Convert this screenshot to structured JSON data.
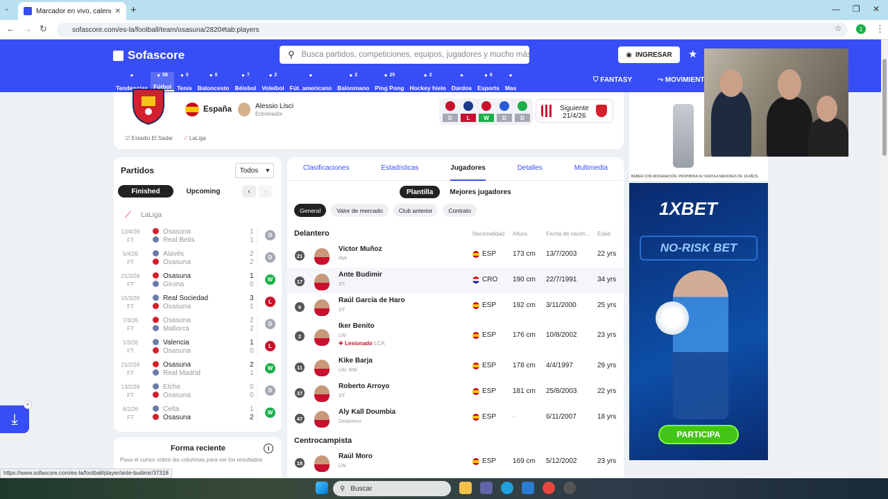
{
  "browser": {
    "tab_title": "Marcador en vivo, calendario y",
    "url": "sofascore.com/es-la/football/team/osasuna/2820#tab:players",
    "status_url": "https://www.sofascore.com/es-la/football/player/ante-budimir/37318"
  },
  "header": {
    "logo": "Sofascore",
    "search_placeholder": "Busca partidos, competiciones, equipos, jugadores y mucho más",
    "login": "INGRESAR",
    "fantasy": "FANTASY",
    "movimientos": "MOVIMIENT"
  },
  "sports": [
    {
      "label": "Tendencias",
      "count": ""
    },
    {
      "label": "Fútbol",
      "count": "58"
    },
    {
      "label": "Tenis",
      "count": "5"
    },
    {
      "label": "Baloncesto",
      "count": "8"
    },
    {
      "label": "Béisbol",
      "count": "7"
    },
    {
      "label": "Voleibol",
      "count": "2"
    },
    {
      "label": "Fút. americano",
      "count": ""
    },
    {
      "label": "Balonmano",
      "count": "2"
    },
    {
      "label": "Ping Pong",
      "count": "25"
    },
    {
      "label": "Hockey hielo",
      "count": "2"
    },
    {
      "label": "Dardos",
      "count": ""
    },
    {
      "label": "Esports",
      "count": "6"
    },
    {
      "label": "Mas",
      "count": ""
    }
  ],
  "team": {
    "country": "España",
    "coach": "Alessio Lisci",
    "coach_role": "Entrenador",
    "venue": "Estadio El Sadar",
    "league": "LaLiga",
    "form": [
      "D",
      "L",
      "W",
      "D",
      "D"
    ],
    "next_label": "Siguiente",
    "next_date": "21/4/26"
  },
  "colors": {
    "brand": "#374df5",
    "win": "#1bb04a",
    "loss": "#c8102e",
    "draw": "#a4a9b3"
  },
  "matches": {
    "title": "Partidos",
    "filter": "Todos",
    "tab_finished": "Finished",
    "tab_upcoming": "Upcoming",
    "league": "LaLiga",
    "rows": [
      {
        "date": "12/4/26",
        "status": "FT",
        "home": "Osasuna",
        "away": "Real Betis",
        "hs": "1",
        "as": "1",
        "res": "D",
        "hw": false,
        "aw": false
      },
      {
        "date": "5/4/26",
        "status": "FT",
        "home": "Alavés",
        "away": "Osasuna",
        "hs": "2",
        "as": "2",
        "res": "D",
        "hw": false,
        "aw": false
      },
      {
        "date": "21/3/26",
        "status": "FT",
        "home": "Osasuna",
        "away": "Girona",
        "hs": "1",
        "as": "0",
        "res": "W",
        "hw": true,
        "aw": false
      },
      {
        "date": "15/3/26",
        "status": "FT",
        "home": "Real Sociedad",
        "away": "Osasuna",
        "hs": "3",
        "as": "1",
        "res": "L",
        "hw": true,
        "aw": false
      },
      {
        "date": "7/3/26",
        "status": "FT",
        "home": "Osasuna",
        "away": "Mallorca",
        "hs": "2",
        "as": "2",
        "res": "D",
        "hw": false,
        "aw": false
      },
      {
        "date": "1/3/26",
        "status": "FT",
        "home": "Valencia",
        "away": "Osasuna",
        "hs": "1",
        "as": "0",
        "res": "L",
        "hw": true,
        "aw": false
      },
      {
        "date": "21/2/26",
        "status": "FT",
        "home": "Osasuna",
        "away": "Real Madrid",
        "hs": "2",
        "as": "1",
        "res": "W",
        "hw": true,
        "aw": false
      },
      {
        "date": "13/2/26",
        "status": "FT",
        "home": "Elche",
        "away": "Osasuna",
        "hs": "0",
        "as": "0",
        "res": "D",
        "hw": false,
        "aw": false
      },
      {
        "date": "6/2/26",
        "status": "FT",
        "home": "Celta",
        "away": "Osasuna",
        "hs": "1",
        "as": "2",
        "res": "W",
        "hw": false,
        "aw": true
      }
    ]
  },
  "form_panel": {
    "title": "Forma reciente",
    "subtitle": "Pasa el cursor sobre las columnas para ver los resultados"
  },
  "main_tabs": [
    "Clasificaciones",
    "Estadísticas",
    "Jugadores",
    "Detalles",
    "Multimedia"
  ],
  "segments": [
    "Plantilla",
    "Mejores jugadores"
  ],
  "filters": [
    "General",
    "Valor de mercado",
    "Club anterior",
    "Contrato"
  ],
  "columns": {
    "nat": "Nacionalidad",
    "height": "Altura",
    "birth": "Fecha de nacim...",
    "age": "Edad"
  },
  "sections": {
    "forwards": "Delantero",
    "midfielders": "Centrocampista"
  },
  "forwards": [
    {
      "num": "21",
      "name": "Victor Muñoz",
      "pos": "RW",
      "nat": "ESP",
      "height": "173 cm",
      "birth": "13/7/2003",
      "age": "22 yrs"
    },
    {
      "num": "17",
      "name": "Ante Budimir",
      "pos": "ST",
      "nat": "CRO",
      "height": "190 cm",
      "birth": "22/7/1991",
      "age": "34 yrs"
    },
    {
      "num": "9",
      "name": "Raúl García de Haro",
      "pos": "ST",
      "nat": "ESP",
      "height": "192 cm",
      "birth": "3/11/2000",
      "age": "25 yrs"
    },
    {
      "num": "2",
      "name": "Iker Benito",
      "pos": "LW",
      "nat": "ESP",
      "height": "176 cm",
      "birth": "10/8/2002",
      "age": "23 yrs",
      "injury": "Lesionado",
      "injury_part": "LCA"
    },
    {
      "num": "11",
      "name": "Kike Barja",
      "pos": "LW, RW",
      "nat": "ESP",
      "height": "178 cm",
      "birth": "4/4/1997",
      "age": "29 yrs"
    },
    {
      "num": "37",
      "name": "Roberto Arroyo",
      "pos": "ST",
      "nat": "ESP",
      "height": "181 cm",
      "birth": "25/8/2003",
      "age": "22 yrs"
    },
    {
      "num": "47",
      "name": "Aly Kall Doumbia",
      "pos": "Delantero",
      "nat": "ESP",
      "height": "-",
      "birth": "6/11/2007",
      "age": "18 yrs"
    }
  ],
  "midfielders": [
    {
      "num": "18",
      "name": "Raúl Moro",
      "pos": "LW",
      "nat": "ESP",
      "height": "169 cm",
      "birth": "5/12/2002",
      "age": "23 yrs"
    }
  ],
  "ads": {
    "brand": "1XBET",
    "tagline": "NO-RISK BET",
    "cta": "PARTICIPA",
    "warning": "BEBER CON MODERACIÓN. PROHIBIDA SU VENTA A MENORES DE 18 AÑOS."
  },
  "taskbar": {
    "search": "Buscar"
  }
}
